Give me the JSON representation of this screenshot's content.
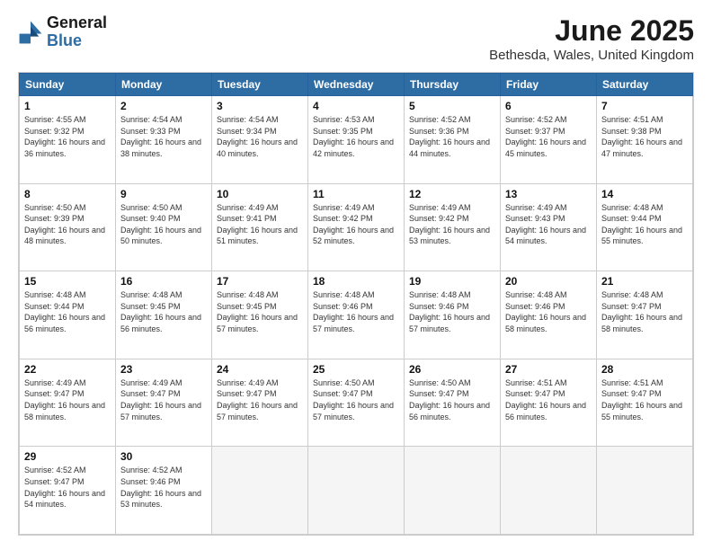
{
  "header": {
    "logo_line1": "General",
    "logo_line2": "Blue",
    "main_title": "June 2025",
    "subtitle": "Bethesda, Wales, United Kingdom"
  },
  "calendar": {
    "days_of_week": [
      "Sunday",
      "Monday",
      "Tuesday",
      "Wednesday",
      "Thursday",
      "Friday",
      "Saturday"
    ],
    "weeks": [
      [
        null,
        {
          "day": "2",
          "rise": "4:54 AM",
          "set": "9:33 PM",
          "daylight": "16 hours and 38 minutes."
        },
        {
          "day": "3",
          "rise": "4:54 AM",
          "set": "9:34 PM",
          "daylight": "16 hours and 40 minutes."
        },
        {
          "day": "4",
          "rise": "4:53 AM",
          "set": "9:35 PM",
          "daylight": "16 hours and 42 minutes."
        },
        {
          "day": "5",
          "rise": "4:52 AM",
          "set": "9:36 PM",
          "daylight": "16 hours and 44 minutes."
        },
        {
          "day": "6",
          "rise": "4:52 AM",
          "set": "9:37 PM",
          "daylight": "16 hours and 45 minutes."
        },
        {
          "day": "7",
          "rise": "4:51 AM",
          "set": "9:38 PM",
          "daylight": "16 hours and 47 minutes."
        }
      ],
      [
        {
          "day": "1",
          "rise": "4:55 AM",
          "set": "9:32 PM",
          "daylight": "16 hours and 36 minutes."
        },
        null,
        null,
        null,
        null,
        null,
        null
      ],
      [
        {
          "day": "8",
          "rise": "4:50 AM",
          "set": "9:39 PM",
          "daylight": "16 hours and 48 minutes."
        },
        {
          "day": "9",
          "rise": "4:50 AM",
          "set": "9:40 PM",
          "daylight": "16 hours and 50 minutes."
        },
        {
          "day": "10",
          "rise": "4:49 AM",
          "set": "9:41 PM",
          "daylight": "16 hours and 51 minutes."
        },
        {
          "day": "11",
          "rise": "4:49 AM",
          "set": "9:42 PM",
          "daylight": "16 hours and 52 minutes."
        },
        {
          "day": "12",
          "rise": "4:49 AM",
          "set": "9:42 PM",
          "daylight": "16 hours and 53 minutes."
        },
        {
          "day": "13",
          "rise": "4:49 AM",
          "set": "9:43 PM",
          "daylight": "16 hours and 54 minutes."
        },
        {
          "day": "14",
          "rise": "4:48 AM",
          "set": "9:44 PM",
          "daylight": "16 hours and 55 minutes."
        }
      ],
      [
        {
          "day": "15",
          "rise": "4:48 AM",
          "set": "9:44 PM",
          "daylight": "16 hours and 56 minutes."
        },
        {
          "day": "16",
          "rise": "4:48 AM",
          "set": "9:45 PM",
          "daylight": "16 hours and 56 minutes."
        },
        {
          "day": "17",
          "rise": "4:48 AM",
          "set": "9:45 PM",
          "daylight": "16 hours and 57 minutes."
        },
        {
          "day": "18",
          "rise": "4:48 AM",
          "set": "9:46 PM",
          "daylight": "16 hours and 57 minutes."
        },
        {
          "day": "19",
          "rise": "4:48 AM",
          "set": "9:46 PM",
          "daylight": "16 hours and 57 minutes."
        },
        {
          "day": "20",
          "rise": "4:48 AM",
          "set": "9:46 PM",
          "daylight": "16 hours and 58 minutes."
        },
        {
          "day": "21",
          "rise": "4:48 AM",
          "set": "9:47 PM",
          "daylight": "16 hours and 58 minutes."
        }
      ],
      [
        {
          "day": "22",
          "rise": "4:49 AM",
          "set": "9:47 PM",
          "daylight": "16 hours and 58 minutes."
        },
        {
          "day": "23",
          "rise": "4:49 AM",
          "set": "9:47 PM",
          "daylight": "16 hours and 57 minutes."
        },
        {
          "day": "24",
          "rise": "4:49 AM",
          "set": "9:47 PM",
          "daylight": "16 hours and 57 minutes."
        },
        {
          "day": "25",
          "rise": "4:50 AM",
          "set": "9:47 PM",
          "daylight": "16 hours and 57 minutes."
        },
        {
          "day": "26",
          "rise": "4:50 AM",
          "set": "9:47 PM",
          "daylight": "16 hours and 56 minutes."
        },
        {
          "day": "27",
          "rise": "4:51 AM",
          "set": "9:47 PM",
          "daylight": "16 hours and 56 minutes."
        },
        {
          "day": "28",
          "rise": "4:51 AM",
          "set": "9:47 PM",
          "daylight": "16 hours and 55 minutes."
        }
      ],
      [
        {
          "day": "29",
          "rise": "4:52 AM",
          "set": "9:47 PM",
          "daylight": "16 hours and 54 minutes."
        },
        {
          "day": "30",
          "rise": "4:52 AM",
          "set": "9:46 PM",
          "daylight": "16 hours and 53 minutes."
        },
        null,
        null,
        null,
        null,
        null
      ]
    ]
  }
}
